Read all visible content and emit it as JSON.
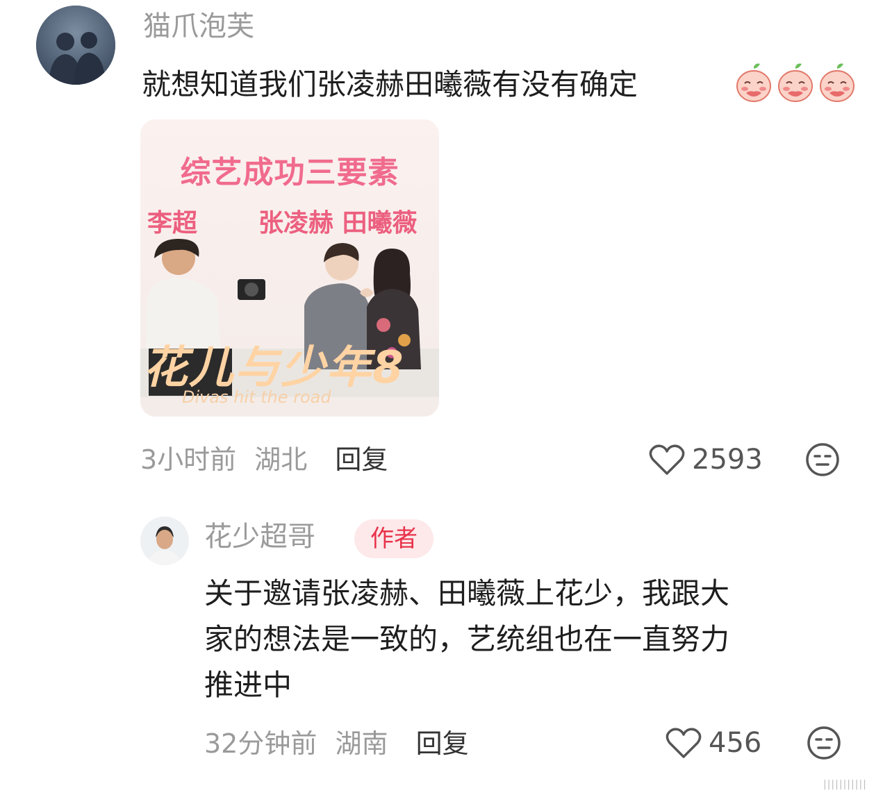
{
  "comment": {
    "username": "猫爪泡芙",
    "text": "就想知道我们张凌赫田曦薇有没有确定",
    "emoji_icons": [
      "blushing-peach-emoji",
      "blushing-peach-emoji",
      "blushing-peach-emoji"
    ],
    "image": {
      "headline": "综艺成功三要素",
      "left_name": "李超",
      "right_names": "张凌赫 田曦薇",
      "show_title": "花儿与少年8",
      "show_subtitle": "Divas hit the road"
    },
    "time": "3小时前",
    "location": "湖北",
    "reply_label": "回复",
    "likes": "2593"
  },
  "reply": {
    "username": "花少超哥",
    "badge": "作者",
    "text_lines": [
      "关于邀请张凌赫、田曦薇上花少，我跟大",
      "家的想法是一致的，艺统组也在一直努力",
      "推进中"
    ],
    "time": "32分钟前",
    "location": "湖南",
    "reply_label": "回复",
    "likes": "456"
  },
  "colors": {
    "meta_gray": "#9a9a9a",
    "badge_bg": "#fde8ea",
    "badge_text": "#e8334a"
  },
  "watermark": "|||||||||||"
}
